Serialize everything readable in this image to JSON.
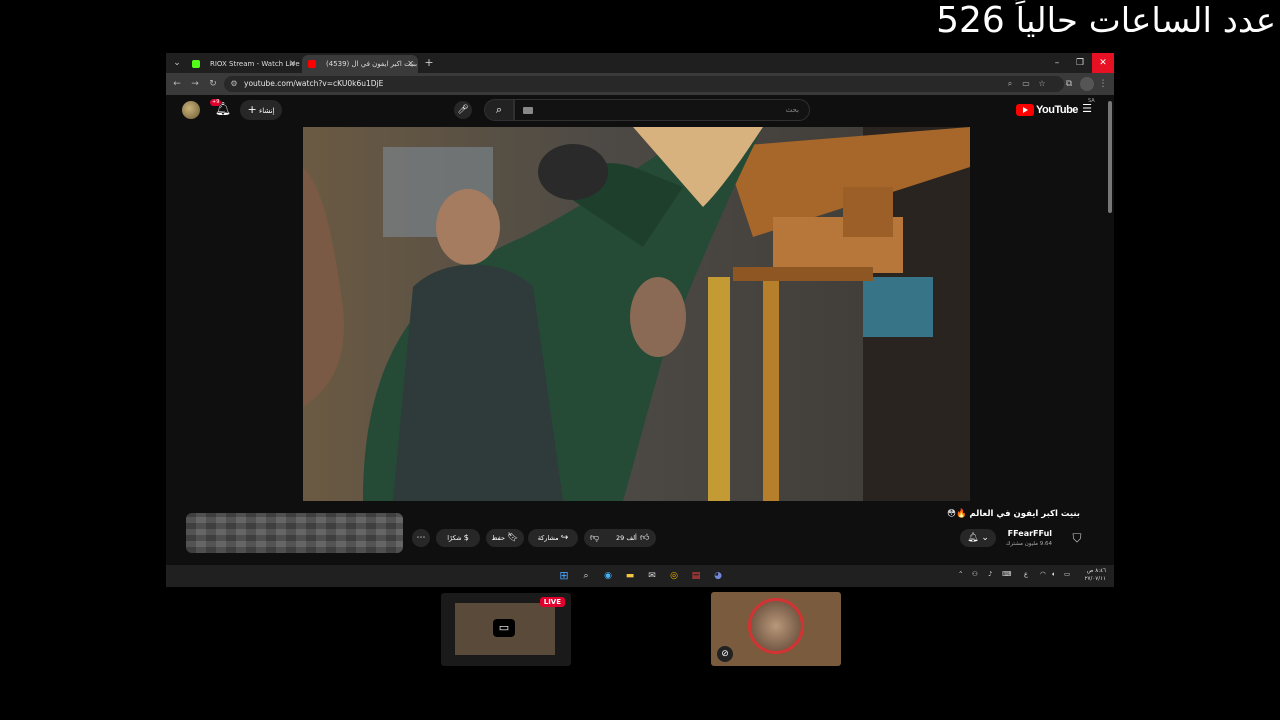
{
  "overlay": {
    "hours_label": "عدد الساعات حالياً",
    "hours_value": "526"
  },
  "browser": {
    "tabs": [
      {
        "title": "RIOX Stream - Watch Live on K",
        "favicon_color": "#53fc18"
      },
      {
        "title": "(4539) بنيت اكبر ايفون في ال",
        "favicon_color": "#ff0000"
      }
    ],
    "url": "youtube.com/watch?v=cKU0k6u1DjE"
  },
  "youtube": {
    "create_label": "إنشاء",
    "notif_badge": "+9",
    "search_placeholder": "بحث",
    "logo_text": "YouTube",
    "logo_region": "SA",
    "video_title": "بنيت اكبر ايفون في العالم 🔥😳",
    "channel_name": "FFearFFul",
    "subscribers": "9.64 مليون مشترك",
    "actions": {
      "likes": "29 ألف",
      "share": "مشاركة",
      "save": "حفظ",
      "thanks": "شكرًا"
    }
  },
  "taskbar": {
    "lang": "ع",
    "time": "٨:٤٦ ص",
    "date": "٢٧/٠٧/١١"
  },
  "previews": {
    "live_badge": "LIVE"
  },
  "colors": {
    "youtube_red": "#ff0000",
    "live_red": "#e1002d",
    "close_red": "#e81123"
  }
}
